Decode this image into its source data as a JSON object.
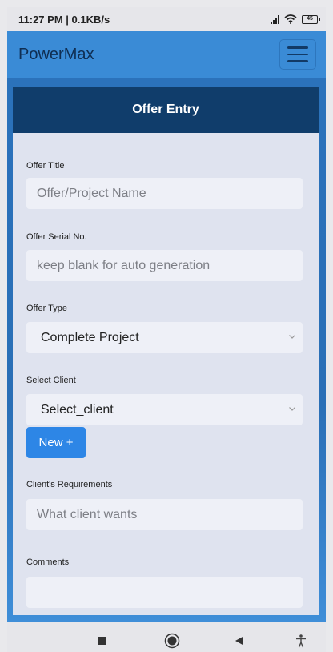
{
  "status_bar": {
    "time_speed": "11:27 PM | 0.1KB/s",
    "battery": "45"
  },
  "navbar": {
    "brand": "PowerMax",
    "menu_icon": "hamburger-menu-icon"
  },
  "form": {
    "header": "Offer Entry",
    "offer_title": {
      "label": "Offer Title",
      "placeholder": "Offer/Project Name"
    },
    "offer_serial": {
      "label": "Offer Serial No.",
      "placeholder": "keep blank for auto generation"
    },
    "offer_type": {
      "label": "Offer Type",
      "value": "Complete Project"
    },
    "select_client": {
      "label": "Select Client",
      "value": "Select_client"
    },
    "new_button": "New +",
    "requirements": {
      "label": "Client's Requirements",
      "placeholder": "What client wants"
    },
    "comments": {
      "label": "Comments",
      "value": ""
    }
  },
  "system_nav": {
    "icons": [
      "recents-square-icon",
      "home-circle-icon",
      "back-triangle-icon",
      "accessibility-icon"
    ]
  },
  "colors": {
    "navbar": "#3a8bd6",
    "card_header": "#103d6b",
    "card_body": "#dfe3ef",
    "button": "#2d86e6"
  }
}
